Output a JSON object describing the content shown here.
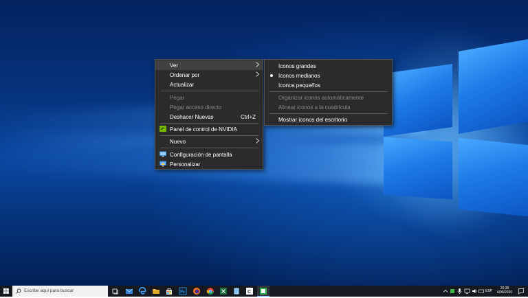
{
  "context_menu": {
    "items": [
      {
        "label": "Ver",
        "submenu": true,
        "hover": true
      },
      {
        "label": "Ordenar por",
        "submenu": true
      },
      {
        "label": "Actualizar"
      },
      {
        "label": "Pegar",
        "disabled": true
      },
      {
        "label": "Pegar acceso directo",
        "disabled": true
      },
      {
        "label": "Deshacer Nuevas",
        "shortcut": "Ctrl+Z"
      },
      {
        "label": "Panel de control de NVIDIA",
        "icon": "nvidia-icon"
      },
      {
        "label": "Nuevo",
        "submenu": true
      },
      {
        "label": "Configuración de pantalla",
        "icon": "display-settings-icon"
      },
      {
        "label": "Personalizar",
        "icon": "personalize-icon"
      }
    ]
  },
  "submenu_ver": {
    "items": [
      {
        "label": "Iconos grandes"
      },
      {
        "label": "Iconos medianos",
        "selected": true
      },
      {
        "label": "Iconos pequeños"
      },
      {
        "label": "Organizar iconos automáticamente",
        "disabled": true
      },
      {
        "label": "Alinear iconos a la cuadrícula",
        "disabled": true
      },
      {
        "label": "Mostrar iconos del escritorio"
      }
    ]
  },
  "taskbar": {
    "search_placeholder": "Escribe aquí para buscar",
    "pinned_icons": [
      "task-view-icon",
      "mail-icon",
      "edge-icon",
      "file-explorer-icon",
      "store-icon",
      "photoshop-icon",
      "firefox-icon",
      "chrome-icon",
      "excel-icon",
      "notepad-icon",
      "app-c-icon",
      "app-green-icon"
    ],
    "tray": {
      "language": "ESP",
      "time": "20:38",
      "date": "4/06/2020"
    }
  },
  "colors": {
    "menu_bg": "#2b2b2b",
    "menu_hover": "#414141",
    "menu_disabled_text": "#8a8a8a",
    "taskbar_bg": "#16191f"
  }
}
